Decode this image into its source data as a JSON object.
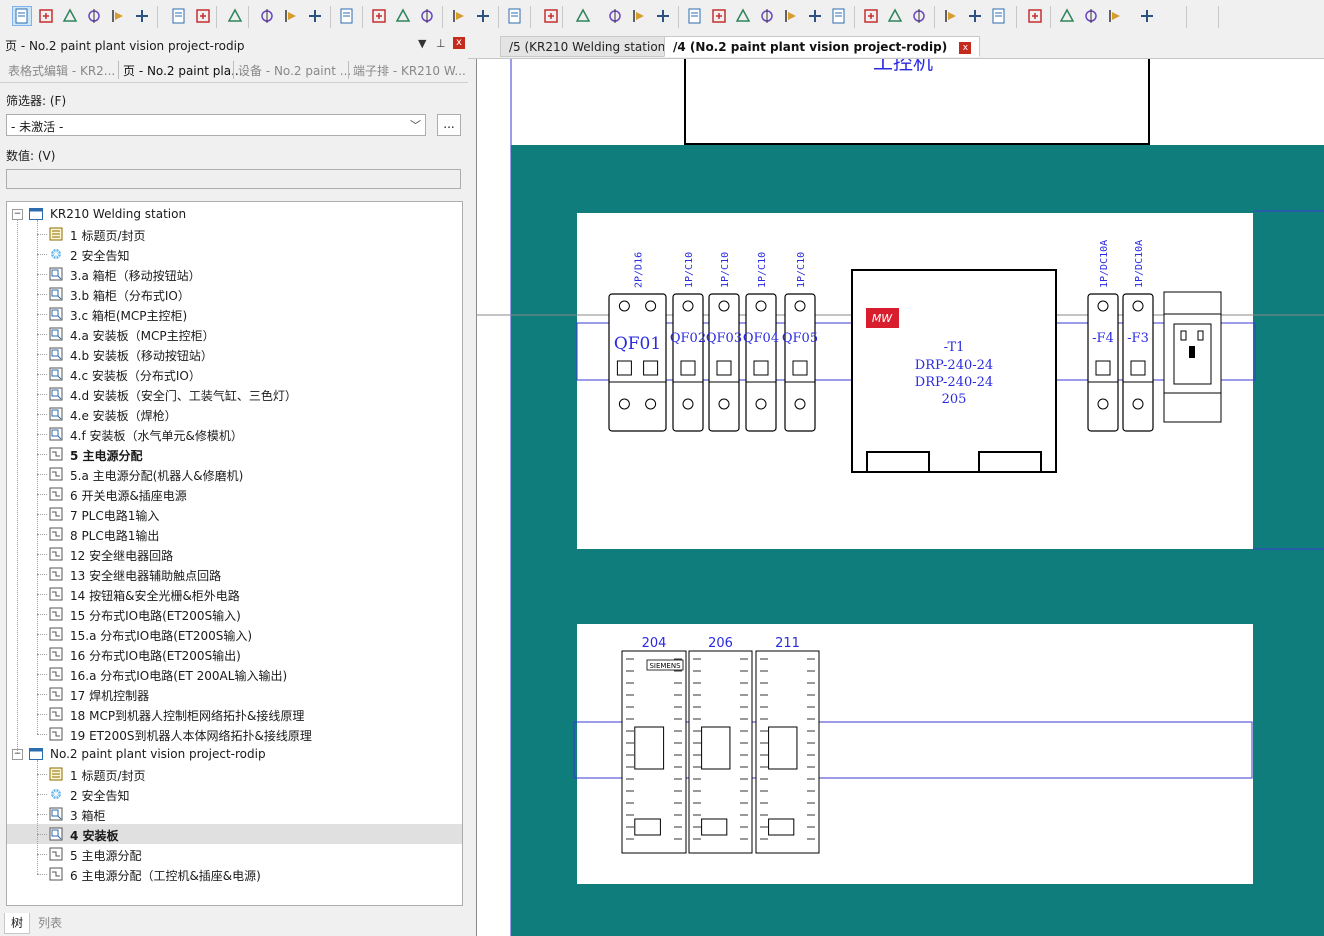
{
  "toolbar": {
    "icons": [
      "page-properties-icon",
      "new-page-icon",
      "open-page-icon",
      "page-settings-icon",
      "undo-page-icon",
      "next-page-icon",
      "graphical-editing-icon",
      "macro-icon",
      "device-icon",
      "plc-terminal-icon",
      "potential-icon",
      "connection-icon",
      "cable-icon",
      "bus-icon",
      "parts-icon",
      "link-icon",
      "delete-icon",
      "symbol-icon",
      "table-icon",
      "snap-icon",
      "zoom-icon",
      "interrupt-point-icon",
      "terminal-strip-icon",
      "wire-icon",
      "wire-add-icon",
      "wire-remove-icon",
      "jump-icon",
      "black-box-icon",
      "plc-box-icon",
      "structure-box-icon",
      "placeholder-icon",
      "line-icon",
      "hatch-icon",
      "dashed-box-icon",
      "ground-icon",
      "bus-connection-icon",
      "potential-link-icon",
      "cross-reference-icon",
      "interruption-icon",
      "angle-icon",
      "t-node-icon",
      "cable-def-icon"
    ]
  },
  "left_panel": {
    "title": "页 - No.2 paint plant vision project-rodip",
    "controls": {
      "dropdown": "▼",
      "pin": "⊥",
      "close": "x"
    },
    "tabs": [
      "表格式编辑 - KR2...",
      "页 - No.2 paint pla...",
      "设备 - No.2 paint ...",
      "端子排 - KR210 W..."
    ],
    "active_tab_index": 1,
    "filter_label": "筛选器: (F)",
    "filter_value": "- 未激活 -",
    "filter_more": "...",
    "value_label": "数值: (V)",
    "value_field": "",
    "bottom_tabs": [
      "树",
      "列表"
    ]
  },
  "tree": {
    "projects": [
      {
        "name": "KR210 Welding station",
        "pages": [
          {
            "label": "1 标题页/封页",
            "icon": "title-page-icon"
          },
          {
            "label": "2 安全告知",
            "icon": "safety-page-icon"
          },
          {
            "label": "3.a 箱柜（移动按钮站）",
            "icon": "layout-page-icon"
          },
          {
            "label": "3.b 箱柜（分布式IO）",
            "icon": "layout-page-icon"
          },
          {
            "label": "3.c 箱柜(MCP主控柜)",
            "icon": "layout-page-icon"
          },
          {
            "label": "4.a 安装板（MCP主控柜）",
            "icon": "layout-page-icon"
          },
          {
            "label": "4.b 安装板（移动按钮站）",
            "icon": "layout-page-icon"
          },
          {
            "label": "4.c 安装板（分布式IO）",
            "icon": "layout-page-icon"
          },
          {
            "label": "4.d 安装板（安全门、工装气缸、三色灯）",
            "icon": "layout-page-icon"
          },
          {
            "label": "4.e 安装板（焊枪）",
            "icon": "layout-page-icon"
          },
          {
            "label": "4.f 安装板（水气单元&修模机）",
            "icon": "layout-page-icon"
          },
          {
            "label": "5 主电源分配",
            "icon": "schematic-page-icon",
            "bold": true
          },
          {
            "label": "5.a 主电源分配(机器人&修磨机)",
            "icon": "schematic-page-icon"
          },
          {
            "label": "6 开关电源&插座电源",
            "icon": "schematic-page-icon"
          },
          {
            "label": "7 PLC电路1输入",
            "icon": "schematic-page-icon"
          },
          {
            "label": "8 PLC电路1输出",
            "icon": "schematic-page-icon"
          },
          {
            "label": "12 安全继电器回路",
            "icon": "schematic-page-icon"
          },
          {
            "label": "13 安全继电器辅助触点回路",
            "icon": "schematic-page-icon"
          },
          {
            "label": "14 按钮箱&安全光栅&柜外电路",
            "icon": "schematic-page-icon"
          },
          {
            "label": "15 分布式IO电路(ET200S输入)",
            "icon": "schematic-page-icon"
          },
          {
            "label": "15.a 分布式IO电路(ET200S输入)",
            "icon": "schematic-page-icon"
          },
          {
            "label": "16 分布式IO电路(ET200S输出)",
            "icon": "schematic-page-icon"
          },
          {
            "label": "16.a 分布式IO电路(ET 200AL输入输出)",
            "icon": "schematic-page-icon"
          },
          {
            "label": "17 焊机控制器",
            "icon": "schematic-page-icon"
          },
          {
            "label": "18 MCP到机器人控制柜网络拓扑&接线原理",
            "icon": "schematic-page-icon"
          },
          {
            "label": "19 ET200S到机器人本体网络拓扑&接线原理",
            "icon": "schematic-page-icon"
          }
        ]
      },
      {
        "name": "No.2 paint plant vision project-rodip",
        "pages": [
          {
            "label": "1 标题页/封页",
            "icon": "title-page-icon"
          },
          {
            "label": "2 安全告知",
            "icon": "safety-page-icon"
          },
          {
            "label": "3 箱柜",
            "icon": "layout-page-icon"
          },
          {
            "label": "4 安装板",
            "icon": "layout-page-icon",
            "bold": true,
            "selected": true
          },
          {
            "label": "5 主电源分配",
            "icon": "schematic-page-icon"
          },
          {
            "label": "6 主电源分配（工控机&插座&电源)",
            "icon": "schematic-page-icon"
          }
        ]
      }
    ]
  },
  "doc_tabs": [
    {
      "label": "/5 (KR210 Welding station)",
      "active": false
    },
    {
      "label": "/4 (No.2 paint plant vision project-rodip)",
      "active": true,
      "close": "x"
    }
  ],
  "drawing": {
    "top_label": "工控机",
    "breakers_left": [
      {
        "rating": "2P/D16",
        "tag": "QF01"
      },
      {
        "rating": "1P/C10",
        "tag": "QF02"
      },
      {
        "rating": "1P/C10",
        "tag": "QF03"
      },
      {
        "rating": "1P/C10",
        "tag": "QF04"
      },
      {
        "rating": "1P/C10",
        "tag": "QF05"
      }
    ],
    "power_supply": {
      "tag": "-T1",
      "model": "DRP-240-24",
      "model2": "DRP-240-24",
      "number": "205",
      "logo": "MW"
    },
    "breakers_right": [
      {
        "rating": "1P/DC10A",
        "tag": "-F4"
      },
      {
        "rating": "1P/DC10A",
        "tag": "-F3"
      }
    ],
    "plc_modules": [
      "204",
      "206",
      "211"
    ],
    "plc_brand": "SIEMENS"
  },
  "colors": {
    "teal": "#0e7d7c",
    "drawing_blue": "#2a2ae0",
    "accent_red": "#c42b1c"
  }
}
